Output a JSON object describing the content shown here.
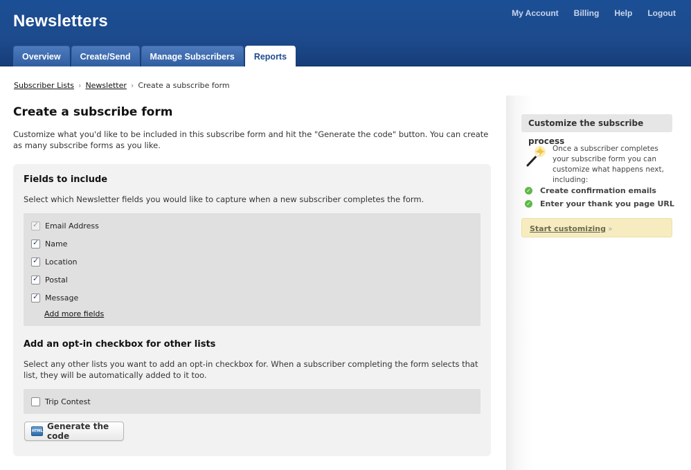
{
  "header": {
    "app_title": "Newsletters",
    "top_nav": [
      "My Account",
      "Billing",
      "Help",
      "Logout"
    ],
    "tabs": [
      {
        "label": "Overview",
        "active": false
      },
      {
        "label": "Create/Send",
        "active": false
      },
      {
        "label": "Manage Subscribers",
        "active": false
      },
      {
        "label": "Reports",
        "active": true
      }
    ]
  },
  "breadcrumb": {
    "items": [
      "Subscriber Lists",
      "Newsletter"
    ],
    "current": "Create a subscribe form",
    "separator": "›"
  },
  "main": {
    "title": "Create a subscribe form",
    "intro": "Customize what you'd like to be included in this subscribe form and hit the \"Generate the code\" button. You can create as many subscribe forms as you like.",
    "fields_section": {
      "title": "Fields to include",
      "description": "Select which Newsletter fields you would like to capture when a new subscriber completes the form.",
      "fields": [
        {
          "label": "Email Address",
          "checked": true,
          "disabled": true
        },
        {
          "label": "Name",
          "checked": true,
          "disabled": false
        },
        {
          "label": "Location",
          "checked": true,
          "disabled": false
        },
        {
          "label": "Postal",
          "checked": true,
          "disabled": false
        },
        {
          "label": "Message",
          "checked": true,
          "disabled": false
        }
      ],
      "add_more_label": "Add more fields"
    },
    "optin_section": {
      "title": "Add an opt-in checkbox for other lists",
      "description": "Select any other lists you want to add an opt-in checkbox for. When a subscriber completing the form selects that list, they will be automatically added to it too.",
      "lists": [
        {
          "label": "Trip Contest",
          "checked": false
        }
      ]
    },
    "generate_button": {
      "label": "Generate the code",
      "icon_text": "HTML"
    }
  },
  "sidebar": {
    "title": "Customize the subscribe process",
    "text": "Once a subscriber completes your subscribe form you can customize what happens next, including:",
    "items": [
      "Create confirmation emails",
      "Enter your thank you page URL"
    ],
    "link_label": "Start customizing",
    "link_suffix": "»"
  },
  "colors": {
    "header_bg": "#1d4a8c",
    "accent_green": "#5fb84a",
    "customize_bg": "#f6ecc0"
  }
}
